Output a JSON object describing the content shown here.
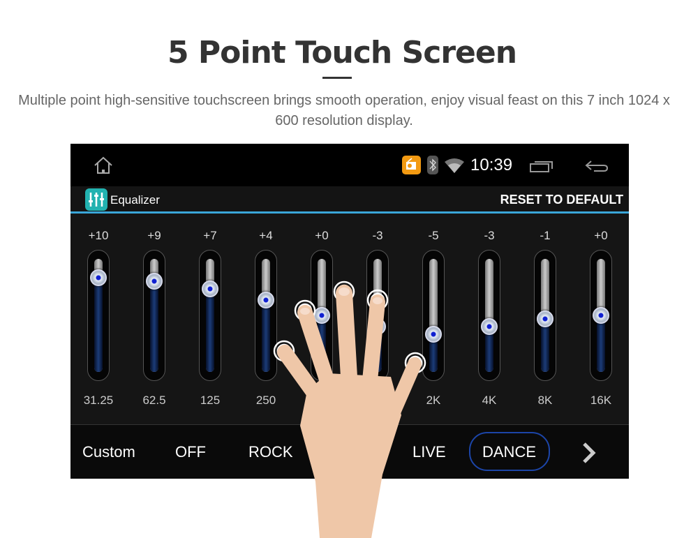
{
  "heading": {
    "title": "5 Point Touch Screen",
    "subtitle": "Multiple point high-sensitive touchscreen brings smooth operation, enjoy visual feast on this 7 inch 1024 x 600 resolution display."
  },
  "status_bar": {
    "time": "10:39",
    "icons": [
      "home-icon",
      "radio-app-icon",
      "bluetooth-icon",
      "wifi-icon",
      "recent-apps-icon",
      "back-icon"
    ]
  },
  "app_bar": {
    "app_name": "Equalizer",
    "reset_label": "RESET TO DEFAULT",
    "accent": "#3aa6d8"
  },
  "equalizer": {
    "range": [
      -15,
      15
    ],
    "bands": [
      {
        "value_label": "+10",
        "value": 10,
        "freq": "31.25"
      },
      {
        "value_label": "+9",
        "value": 9,
        "freq": "62.5"
      },
      {
        "value_label": "+7",
        "value": 7,
        "freq": "125"
      },
      {
        "value_label": "+4",
        "value": 4,
        "freq": "250"
      },
      {
        "value_label": "+0",
        "value": 0,
        "freq": ""
      },
      {
        "value_label": "-3",
        "value": -3,
        "freq": ""
      },
      {
        "value_label": "-5",
        "value": -5,
        "freq": "2K"
      },
      {
        "value_label": "-3",
        "value": -3,
        "freq": "4K"
      },
      {
        "value_label": "-1",
        "value": -1,
        "freq": "8K"
      },
      {
        "value_label": "+0",
        "value": 0,
        "freq": "16K"
      }
    ]
  },
  "presets": {
    "items": [
      "Custom",
      "OFF",
      "ROCK",
      "LIVE",
      "DANCE"
    ],
    "selected": "DANCE",
    "selected_color": "#1c45a8",
    "next_icon": "chevron-right-icon"
  }
}
